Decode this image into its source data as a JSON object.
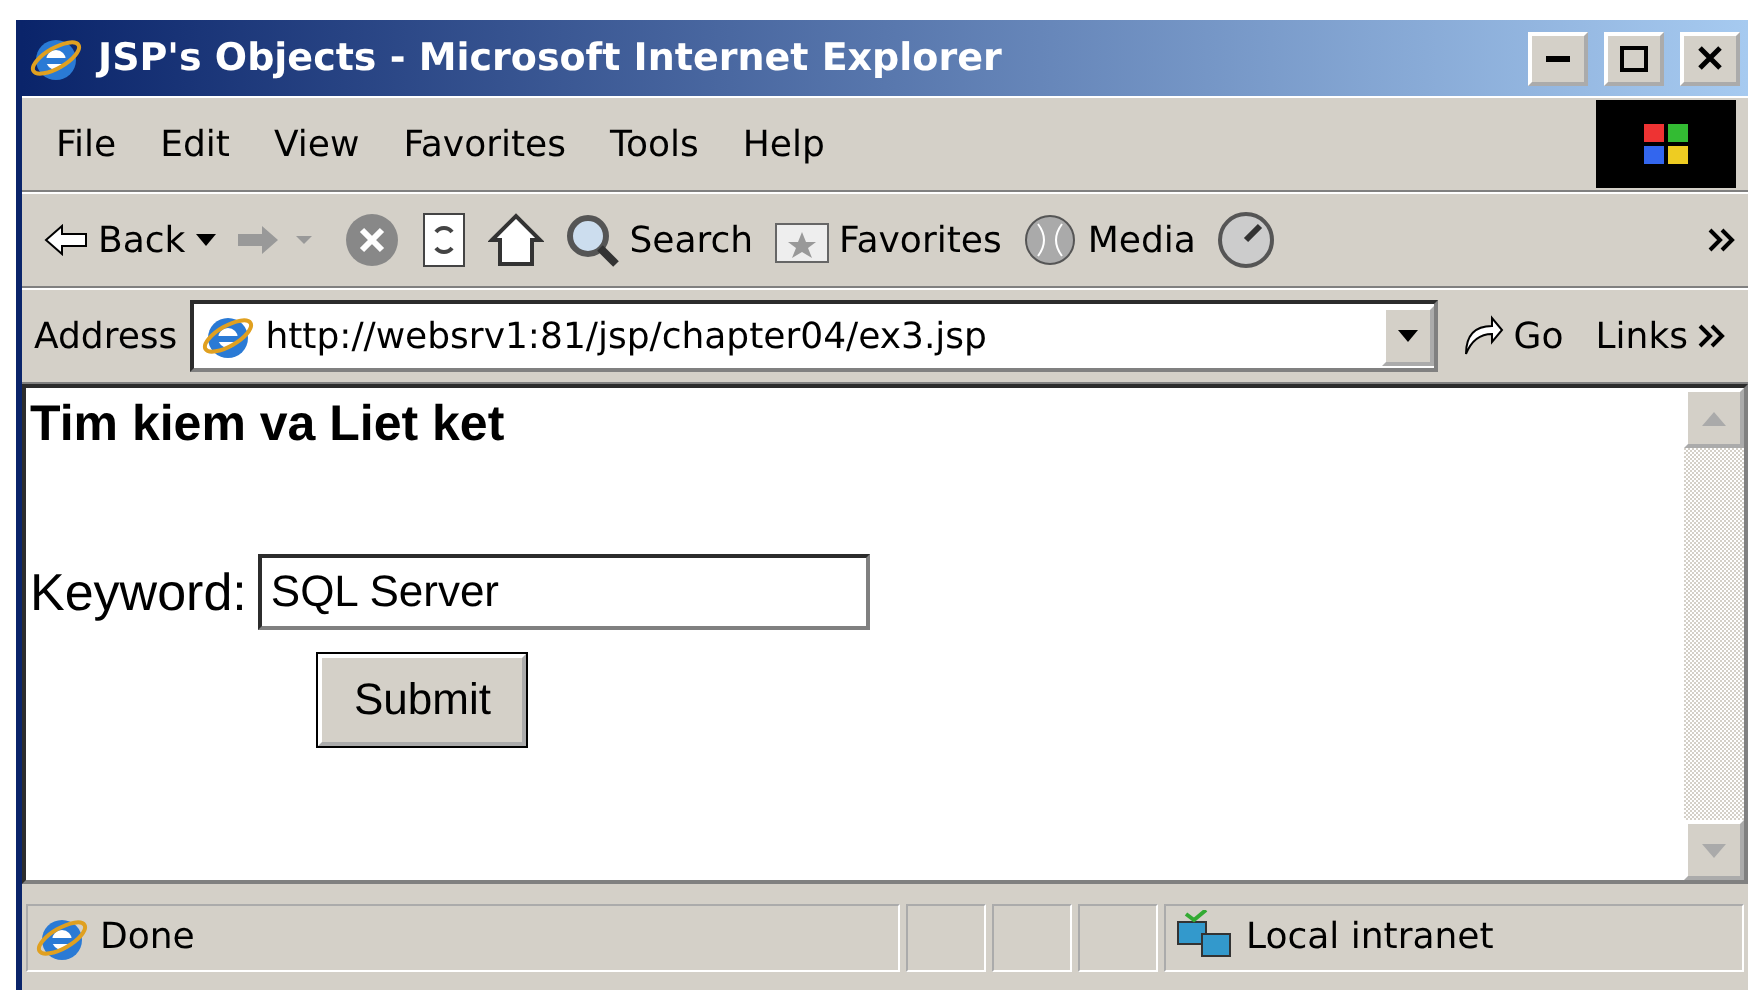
{
  "window": {
    "title": "JSP's Objects - Microsoft Internet Explorer"
  },
  "menu": [
    "File",
    "Edit",
    "View",
    "Favorites",
    "Tools",
    "Help"
  ],
  "toolbar": [
    {
      "kind": "back",
      "label": "Back"
    },
    {
      "kind": "forward"
    },
    {
      "kind": "stop"
    },
    {
      "kind": "refresh"
    },
    {
      "kind": "home"
    },
    {
      "kind": "search",
      "label": "Search"
    },
    {
      "kind": "favorites",
      "label": "Favorites"
    },
    {
      "kind": "media",
      "label": "Media"
    },
    {
      "kind": "history"
    }
  ],
  "address": {
    "label": "Address",
    "value": "http://websrv1:81/jsp/chapter04/ex3.jsp",
    "go": "Go",
    "links": "Links"
  },
  "page": {
    "heading": "Tim kiem va Liet ket",
    "field_label": "Keyword:",
    "field_value": "SQL Server",
    "button": "Submit"
  },
  "status_bar": {
    "text": "Done",
    "zone": "Local intranet"
  }
}
